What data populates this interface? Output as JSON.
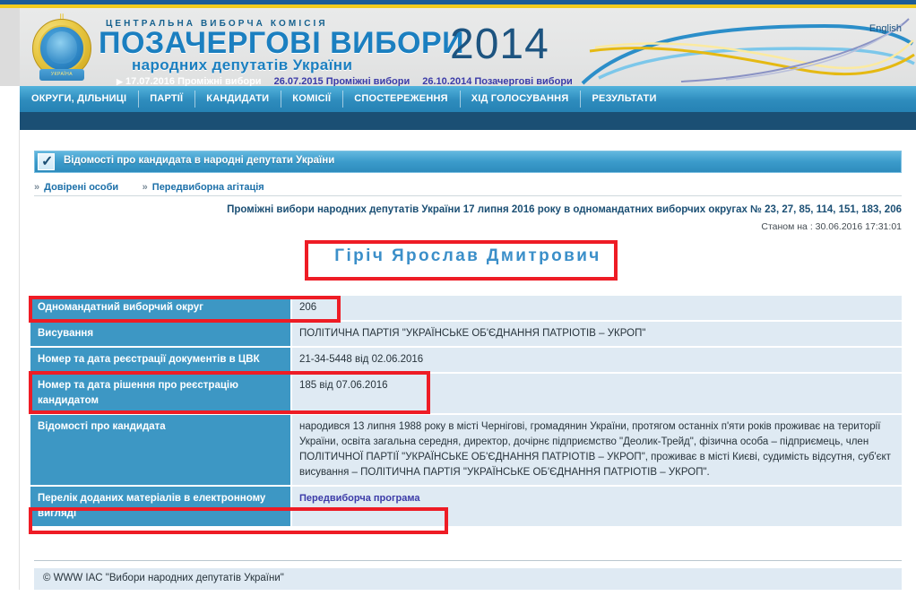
{
  "header": {
    "organization": "ЦЕНТРАЛЬНА ВИБОРЧА КОМІСІЯ",
    "title_line1": "ПОЗАЧЕРГОВІ ВИБОРИ",
    "title_line2": "народних депутатів України",
    "year": "2014",
    "language_link": "English",
    "emblem_banner": "УКРАЇНА",
    "date_links": [
      {
        "label": "17.07.2016 Проміжні вибори",
        "active": true
      },
      {
        "label": "26.07.2015 Проміжні вибори",
        "active": false
      },
      {
        "label": "26.10.2014 Позачергові вибори",
        "active": false
      }
    ]
  },
  "nav": {
    "items": [
      "ОКРУГИ, ДІЛЬНИЦІ",
      "ПАРТІЇ",
      "КАНДИДАТИ",
      "КОМІСІЇ",
      "СПОСТЕРЕЖЕННЯ",
      "ХІД ГОЛОСУВАННЯ",
      "РЕЗУЛЬТАТИ"
    ]
  },
  "section": {
    "icon": "checkbox-checked-icon",
    "title": "Відомості про кандидата в народні депутати України",
    "sublinks": [
      "Довірені особи",
      "Передвиборна агітація"
    ]
  },
  "page_info": {
    "election_title": "Проміжні вибори народних депутатів України 17 липня 2016 року в одномандатних виборчих округах № 23, 27, 85, 114, 151, 183, 206",
    "status": "Станом на : 30.06.2016 17:31:01"
  },
  "candidate": {
    "name": "Гіріч Ярослав Дмитрович"
  },
  "table": {
    "rows": [
      {
        "label": "Одномандатний виборчий округ",
        "value": "206",
        "highlighted": true
      },
      {
        "label": "Висування",
        "value": "ПОЛІТИЧНА ПАРТІЯ \"УКРАЇНСЬКЕ ОБ'ЄДНАННЯ ПАТРІОТІВ – УКРОП\"",
        "highlighted": false
      },
      {
        "label": "Номер та дата реєстрації документів в ЦВК",
        "value": "21-34-5448 від 02.06.2016",
        "highlighted": false
      },
      {
        "label": "Номер та дата рішення про реєстрацію кандидатом",
        "value": "185 від 07.06.2016",
        "highlighted": true
      },
      {
        "label": "Відомості про кандидата",
        "value": "народився 13 липня 1988 року в місті Чернігові, громадянин України, протягом останніх п'яти років проживає на території України, освіта загальна середня, директор, дочірнє підприємство \"Деолик-Трейд\", фізична особа – підприємець, член ПОЛІТИЧНОЇ ПАРТІЇ \"УКРАЇНСЬКЕ ОБ'ЄДНАННЯ ПАТРІОТІВ – УКРОП\", проживає в місті Києві, судимість відсутня, суб'єкт висування – ПОЛІТИЧНА ПАРТІЯ \"УКРАЇНСЬКЕ ОБ'ЄДНАННЯ ПАТРІОТІВ – УКРОП\".",
        "highlighted": false
      },
      {
        "label": "Перелік доданих матеріалів в електронному вигляді",
        "value": "Передвиборча програма",
        "is_link": true,
        "highlighted": true
      }
    ]
  },
  "footer": {
    "copyright": "© WWW IAC \"Вибори народних депутатів України\""
  },
  "colors": {
    "brand_blue": "#1b7fc0",
    "header_dark_blue": "#1d5480",
    "nav_dark": "#1b4f74",
    "label_cell": "#3d97c4",
    "value_cell": "#dfeaf3",
    "annotation_red": "#ee1c25",
    "link_purple": "#3b3ba8",
    "accent_yellow": "#f2cb1d"
  }
}
